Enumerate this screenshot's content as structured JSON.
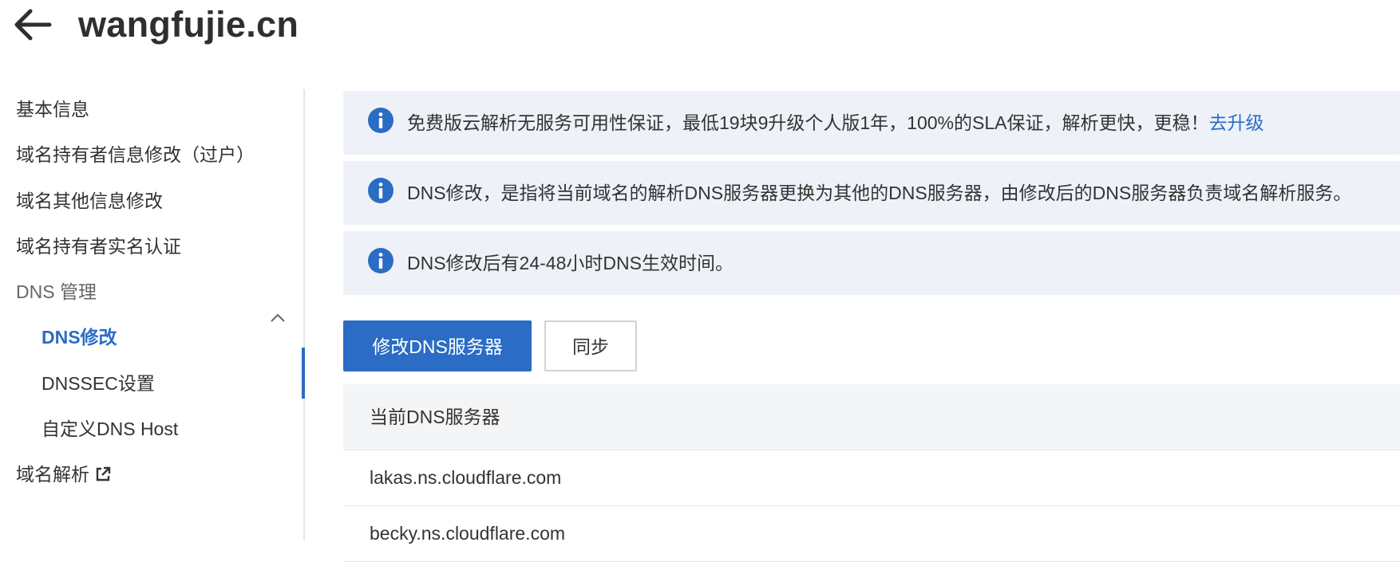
{
  "header": {
    "title": "wangfujie.cn",
    "back_icon": "arrow-left-icon"
  },
  "sidebar": {
    "items": [
      {
        "label": "基本信息"
      },
      {
        "label": "域名持有者信息修改（过户）"
      },
      {
        "label": "域名其他信息修改"
      },
      {
        "label": "域名持有者实名认证"
      },
      {
        "label": "DNS 管理",
        "expanded": true
      },
      {
        "label": "DNS修改",
        "active": true
      },
      {
        "label": "DNSSEC设置"
      },
      {
        "label": "自定义DNS Host"
      },
      {
        "label": "域名解析",
        "icon": "external-link-icon"
      }
    ]
  },
  "alerts": [
    {
      "icon": "info-icon",
      "text": "免费版云解析无服务可用性保证，最低19块9升级个人版1年，100%的SLA保证，解析更快，更稳！",
      "link": "去升级"
    },
    {
      "icon": "info-icon",
      "text": "DNS修改，是指将当前域名的解析DNS服务器更换为其他的DNS服务器，由修改后的DNS服务器负责域名解析服务。"
    },
    {
      "icon": "info-icon",
      "text": "DNS修改后有24-48小时DNS生效时间。"
    }
  ],
  "actions": {
    "modify_label": "修改DNS服务器",
    "sync_label": "同步"
  },
  "table": {
    "header": "当前DNS服务器",
    "rows": [
      "lakas.ns.cloudflare.com",
      "becky.ns.cloudflare.com"
    ]
  },
  "colors": {
    "accent": "#2b6cc4",
    "alert_bg": "#eef2f8",
    "table_header_bg": "#f4f5f7"
  }
}
